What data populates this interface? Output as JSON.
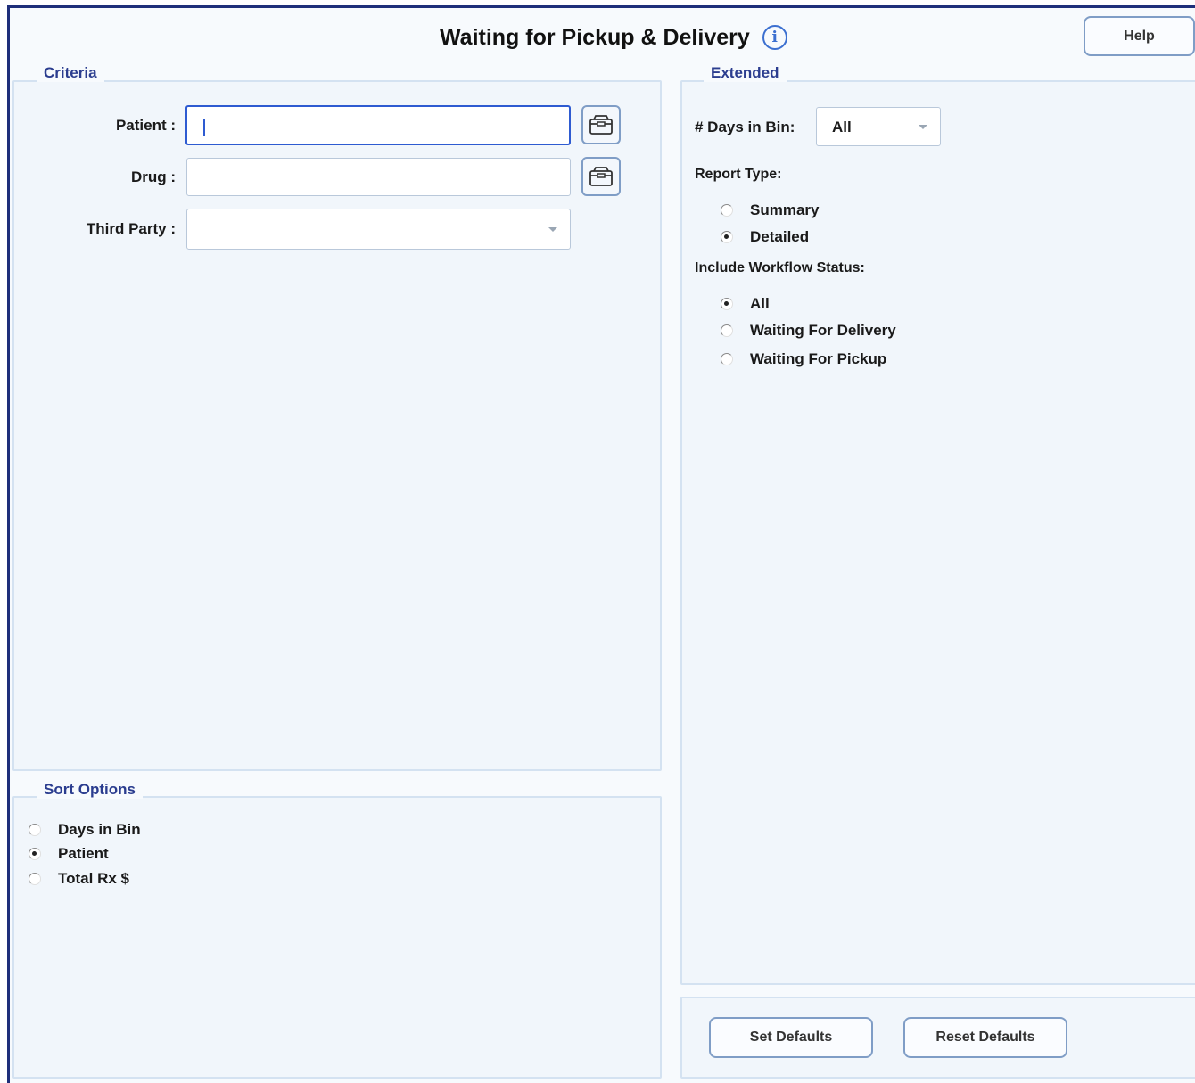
{
  "header": {
    "title": "Waiting for Pickup & Delivery",
    "help_label": "Help"
  },
  "criteria": {
    "legend": "Criteria",
    "patient_label": "Patient :",
    "patient_value": "",
    "drug_label": "Drug :",
    "drug_value": "",
    "third_party_label": "Third Party :",
    "third_party_value": ""
  },
  "extended": {
    "legend": "Extended",
    "days_in_bin_label": "# Days in Bin:",
    "days_in_bin_value": "All",
    "report_type_label": "Report Type:",
    "report_type_options": [
      {
        "label": "Summary",
        "checked": false
      },
      {
        "label": "Detailed",
        "checked": true
      }
    ],
    "workflow_label": "Include Workflow Status:",
    "workflow_options": [
      {
        "label": "All",
        "checked": true
      },
      {
        "label": "Waiting For Delivery",
        "checked": false
      },
      {
        "label": "Waiting For Pickup",
        "checked": false
      }
    ]
  },
  "sort_options": {
    "legend": "Sort Options",
    "options": [
      {
        "label": "Days in Bin",
        "checked": false
      },
      {
        "label": "Patient",
        "checked": true
      },
      {
        "label": "Total Rx $",
        "checked": false
      }
    ]
  },
  "footer": {
    "set_defaults_label": "Set Defaults",
    "reset_defaults_label": "Reset Defaults"
  },
  "icons": {
    "info": "info-icon",
    "lookup": "lookup-icon",
    "dropdown": "chevron-down-icon"
  }
}
